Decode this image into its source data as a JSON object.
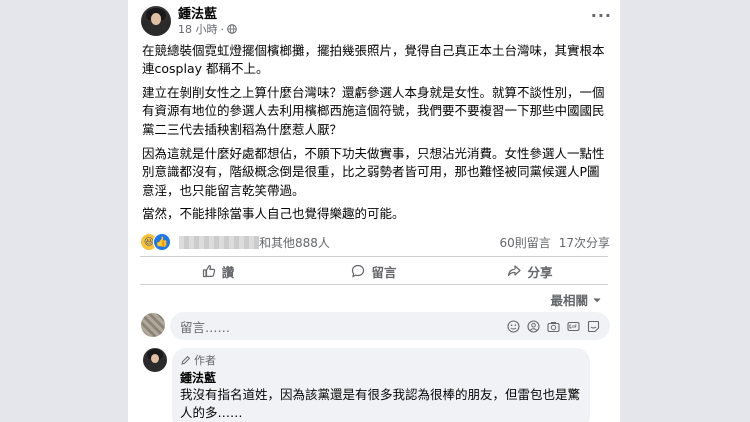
{
  "post": {
    "author": "鍾法藍",
    "time": "18 小時",
    "paragraphs": [
      "在競總裝個霓虹燈擺個檳榔攤，擺拍幾張照片，覺得自己真正本土台灣味，其實根本連cosplay 都稱不上。",
      "建立在剝削女性之上算什麼台灣味？還虧參選人本身就是女性。就算不談性別，一個有資源有地位的參選人去利用檳榔西施這個符號，我們要不要複習一下那些中國國民黨二三代去插秧割稻為什麼惹人厭？",
      "因為這就是什麼好處都想佔，不願下功夫做實事，只想沾光消費。女性參選人一點性別意識都沒有，階級概念倒是很重，比之弱勢者皆可用，那也難怪被同黨候選人P圖意淫，也只能留言乾笑帶過。",
      "當然，不能排除當事人自己也覺得樂趣的可能。"
    ]
  },
  "reactions": {
    "others": "和其他888人",
    "comments": "60則留言",
    "shares": "17次分享"
  },
  "actions": {
    "like": "讚",
    "comment": "留言",
    "share": "分享"
  },
  "sort": {
    "label": "最相關"
  },
  "compose": {
    "placeholder": "留言……"
  },
  "comment": {
    "badge": "作者",
    "author": "鍾法藍",
    "text": "我沒有指名道姓，因為該黨還是有很多我認為很棒的朋友，但雷包也是驚人的多……"
  },
  "colors": {
    "accent": "#1877f2",
    "secondary_text": "#65676b",
    "bubble": "#f0f2f5"
  }
}
